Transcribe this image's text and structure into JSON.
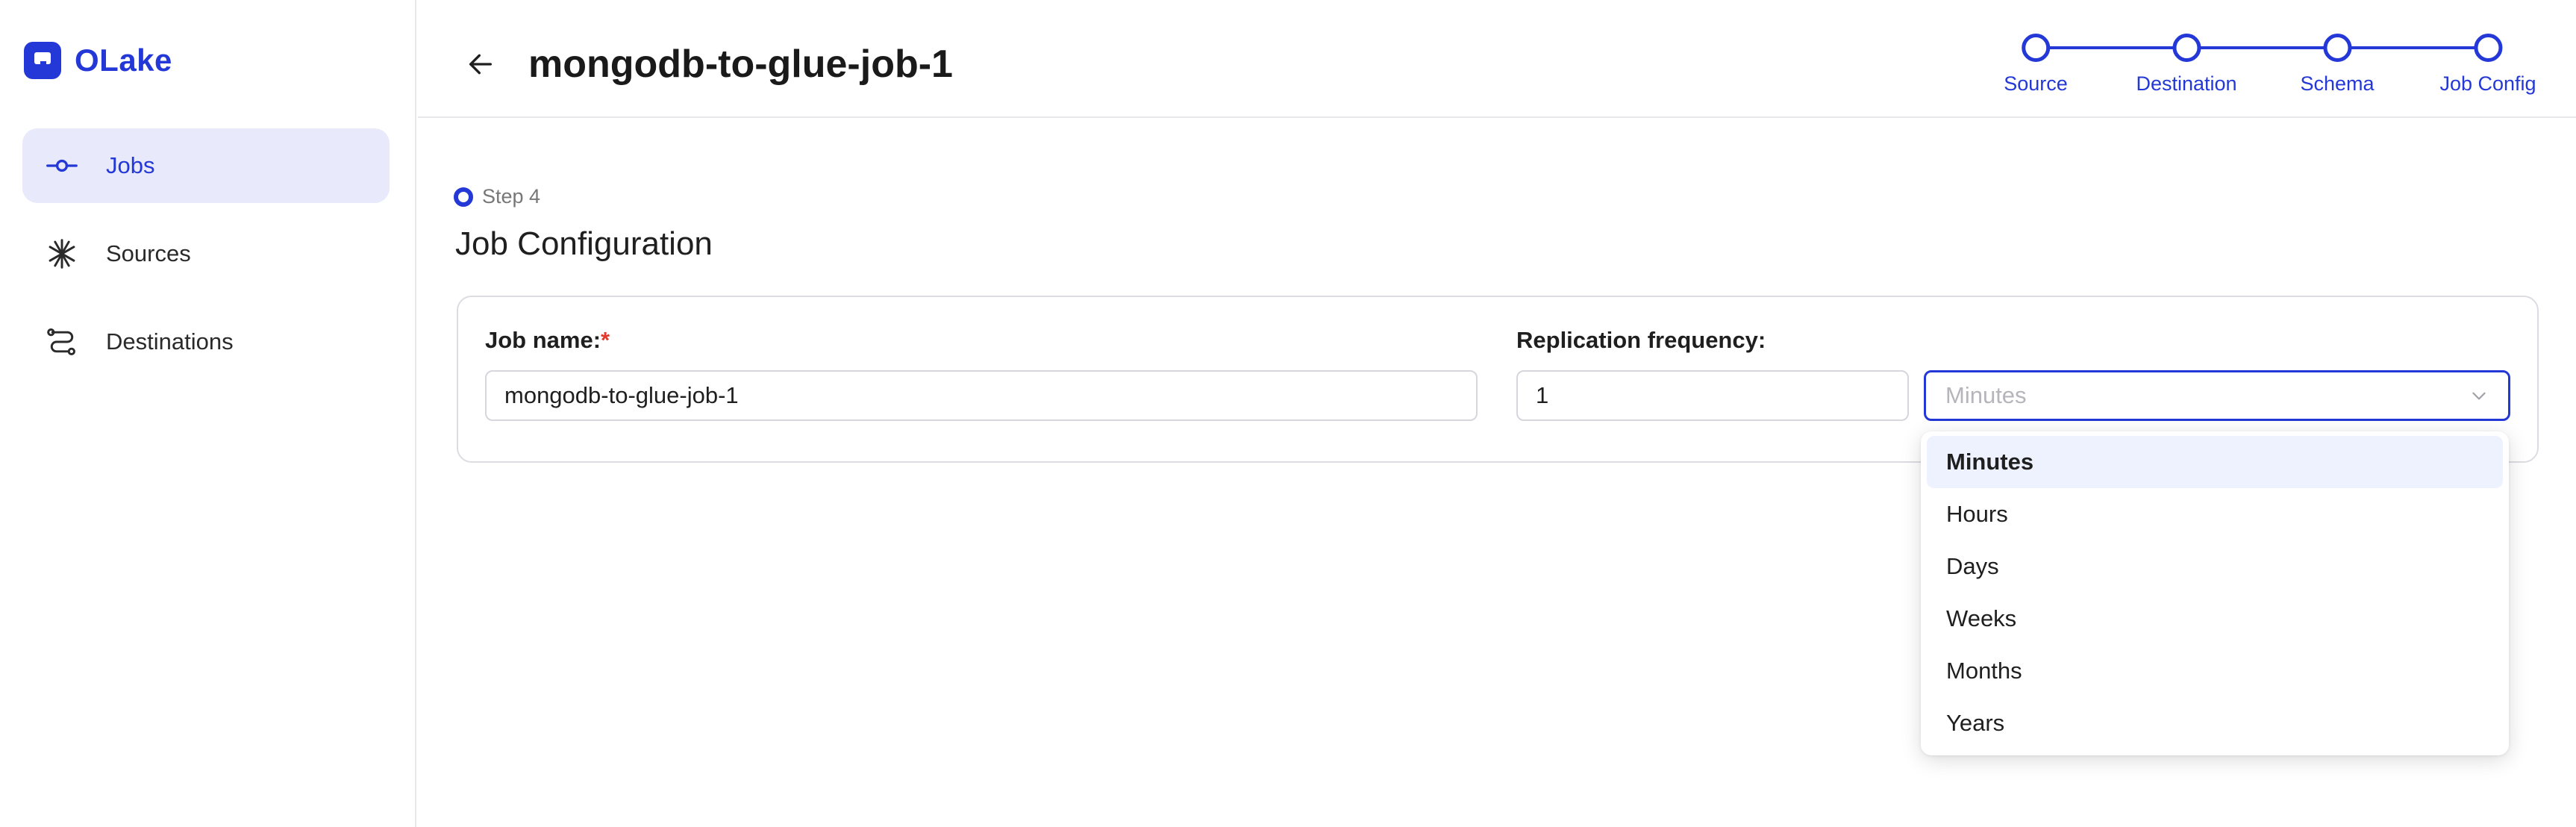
{
  "brand": {
    "name": "OLake"
  },
  "sidebar": {
    "items": [
      {
        "label": "Jobs",
        "icon": "commit-icon",
        "active": true
      },
      {
        "label": "Sources",
        "icon": "asterisk-icon",
        "active": false
      },
      {
        "label": "Destinations",
        "icon": "route-icon",
        "active": false
      }
    ]
  },
  "header": {
    "title": "mongodb-to-glue-job-1",
    "steps": [
      "Source",
      "Destination",
      "Schema",
      "Job Config"
    ]
  },
  "content": {
    "step_tag": "Step 4",
    "section_title": "Job Configuration",
    "job_name_label": "Job name:",
    "job_name_required": "*",
    "job_name_value": "mongodb-to-glue-job-1",
    "frequency_label": "Replication frequency:",
    "frequency_value": "1",
    "frequency_unit_placeholder": "Minutes"
  },
  "dropdown": {
    "options": [
      "Minutes",
      "Hours",
      "Days",
      "Weeks",
      "Months",
      "Years"
    ],
    "highlighted": "Minutes"
  },
  "colors": {
    "accent": "#2338d6",
    "active_nav_bg": "#e8e9fb",
    "required": "#e0392e"
  }
}
